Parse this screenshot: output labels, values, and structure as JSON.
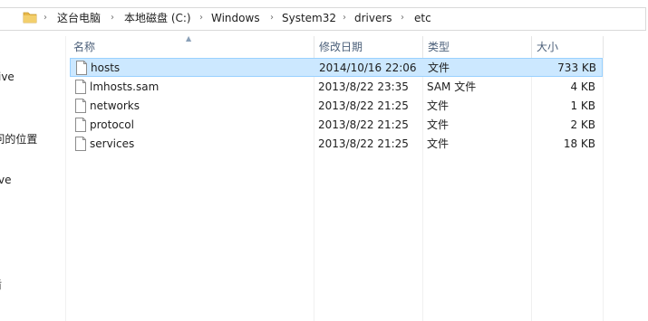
{
  "breadcrumb": [
    "这台电脑",
    "本地磁盘 (C:)",
    "Windows",
    "System32",
    "drivers",
    "etc"
  ],
  "nav": {
    "items": [
      "ive",
      "l问的位置",
      "ve",
      "盾"
    ]
  },
  "columns": {
    "name": "名称",
    "modified": "修改日期",
    "type": "类型",
    "size": "大小"
  },
  "files": [
    {
      "name": "hosts",
      "modified": "2014/10/16 22:06",
      "type": "文件",
      "size": "733 KB",
      "selected": true
    },
    {
      "name": "lmhosts.sam",
      "modified": "2013/8/22 23:35",
      "type": "SAM 文件",
      "size": "4 KB",
      "selected": false
    },
    {
      "name": "networks",
      "modified": "2013/8/22 21:25",
      "type": "文件",
      "size": "1 KB",
      "selected": false
    },
    {
      "name": "protocol",
      "modified": "2013/8/22 21:25",
      "type": "文件",
      "size": "2 KB",
      "selected": false
    },
    {
      "name": "services",
      "modified": "2013/8/22 21:25",
      "type": "文件",
      "size": "18 KB",
      "selected": false
    }
  ],
  "colors": {
    "selection_bg": "#cce8ff",
    "selection_border": "#99d1ff",
    "header_text": "#4c607a",
    "folder": "#e8b84a"
  },
  "icons": {
    "address_folder": "folder-icon",
    "file": "file-icon",
    "breadcrumb_separator": "chevron-right-icon",
    "sort_indicator": "sort-up-icon"
  }
}
